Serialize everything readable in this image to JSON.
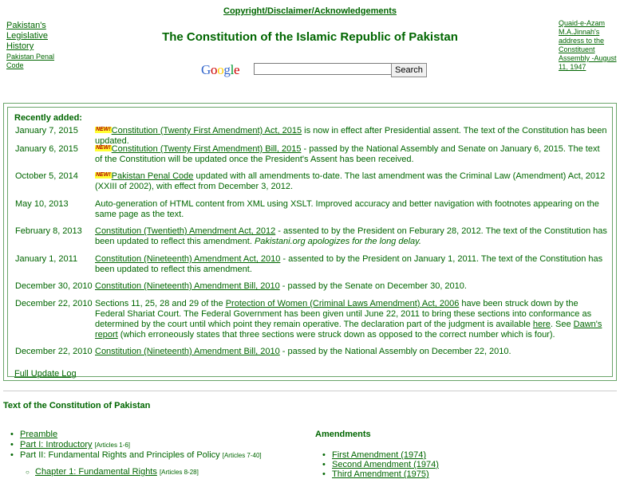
{
  "header": {
    "copyright_link": "Copyright/Disclaimer/Acknowledgements",
    "title": "The Constitution of the Islamic Republic of Pakistan",
    "left_links": [
      "Pakistan's",
      "Legislative",
      "History"
    ],
    "left_small_links": [
      "Pakistan Penal",
      "Code"
    ],
    "right_link_lines": [
      "Quaid-e-Azam",
      "M.A.Jinnah's",
      "address to the",
      "Constituent",
      "Assembly -August",
      "11, 1947"
    ]
  },
  "search": {
    "logo_text": "Google",
    "logo_colors": [
      "#3366cc",
      "#cc0000",
      "#ffcc00",
      "#3366cc",
      "#009933",
      "#cc0000"
    ],
    "input_value": "",
    "button_label": "Search"
  },
  "recent": {
    "heading": "Recently added:",
    "badge": "NEW!",
    "entries": [
      {
        "date": "January 7, 2015",
        "new": true,
        "link": "Constitution (Twenty First Amendment) Act, 2015",
        "text": " is now in effect after Presidential assent. The text of the Constitution has been updated."
      },
      {
        "date": "January 6, 2015",
        "new": true,
        "link": "Constitution (Twenty First Amendment) Bill, 2015",
        "text": " - passed by the National Assembly and Senate on January 6, 2015. The text of the Constitution will be updated once the President's Assent has been received."
      },
      {
        "date": "October 5, 2014",
        "new": true,
        "link": "Pakistan Penal Code",
        "text": " updated with all amendments to-date. The last amendment was the Criminal Law (Amendment) Act, 2012 (XXIII of 2002), with effect from December 3, 2012."
      },
      {
        "date": "May 10, 2013",
        "new": false,
        "link": "",
        "text": "Auto-generation of HTML content from XML using XSLT. Improved accuracy and better navigation with footnotes appearing on the same page as the text."
      },
      {
        "date": "February 8, 2013",
        "new": false,
        "link": "Constitution (Twentieth) Amendment Act, 2012",
        "text": " - assented to by the President on Feburary 28, 2012. The text of the Constitution has been updated to reflect this amendment. ",
        "italic": "Pakistani.org apologizes for the long delay."
      },
      {
        "date": "January 1, 2011",
        "new": false,
        "link": "Constitution (Nineteenth) Amendment Act, 2010",
        "text": " - assented to by the President on January 1, 2011. The text of the Constitution has been updated to reflect this amendment."
      },
      {
        "date": "December 30, 2010",
        "new": false,
        "link": "Constitution (Nineteenth) Amendment Bill, 2010",
        "text": " - passed by the Senate on December 30, 2010."
      },
      {
        "date": "December 22, 2010",
        "new": false,
        "pre": "Sections 11, 25, 28 and 29 of the ",
        "link": "Protection of Women (Criminal Laws Amendment) Act, 2006",
        "mid": " have been struck down by the Federal Shariat Court. The Federal Government has been given until June 22, 2011 to bring these sections into conformance as determined by the court until which point they remain operative. The declaration part of the judgment is available ",
        "link2": "here",
        "mid2": ". See ",
        "link3": "Dawn's report",
        "text": " (which erroneously states that three sections were struck down as opposed to the correct number which is four)."
      },
      {
        "date": "December 22, 2010",
        "new": false,
        "link": "Constitution (Nineteenth) Amendment Bill, 2010",
        "text": " - passed by the National Assembly on December 22, 2010."
      }
    ],
    "full_log_link": "Full Update Log"
  },
  "toc": {
    "title": "Text of the Constitution of Pakistan",
    "items": [
      {
        "label": "Preamble",
        "link": true,
        "range": ""
      },
      {
        "label": "Part I: Introductory",
        "link": true,
        "range": "[Articles 1-6]"
      },
      {
        "label": "Part II: Fundamental Rights and Principles of Policy",
        "link": false,
        "range": "[Articles 7-40]"
      }
    ],
    "sub_items": [
      {
        "label": "Chapter 1: Fundamental Rights",
        "range": "[Articles 8-28]"
      }
    ]
  },
  "amendments": {
    "title": "Amendments",
    "items": [
      "First Amendment (1974)",
      "Second Amendment (1974)",
      "Third Amendment (1975)"
    ]
  }
}
